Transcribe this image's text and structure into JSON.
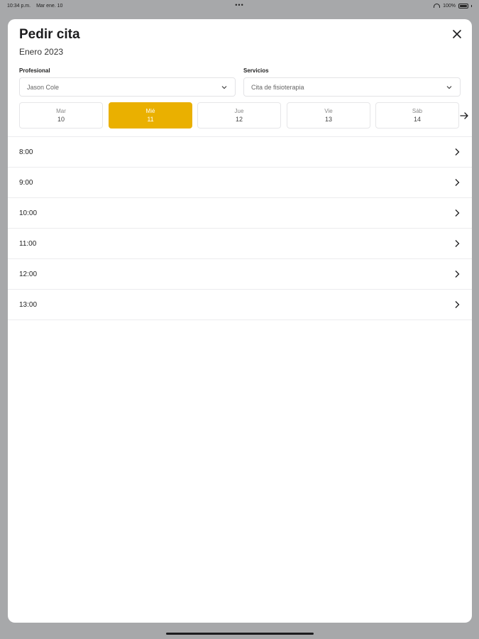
{
  "status_bar": {
    "time": "10:34 p.m.",
    "date": "Mar ene. 10",
    "dots": "•••",
    "battery": "100%"
  },
  "sheet": {
    "title": "Pedir cita",
    "subtitle": "Enero 2023"
  },
  "filters": {
    "professional_label": "Profesional",
    "professional_value": "Jason Cole",
    "services_label": "Servicios",
    "services_value": "Cita de fisioterapia"
  },
  "days": [
    {
      "dow": "Mar",
      "num": "10",
      "selected": false
    },
    {
      "dow": "Mié",
      "num": "11",
      "selected": true
    },
    {
      "dow": "Jue",
      "num": "12",
      "selected": false
    },
    {
      "dow": "Vie",
      "num": "13",
      "selected": false
    },
    {
      "dow": "Sáb",
      "num": "14",
      "selected": false
    }
  ],
  "slots": [
    "8:00",
    "9:00",
    "10:00",
    "11:00",
    "12:00",
    "13:00"
  ],
  "colors": {
    "accent": "#eab000",
    "background": "#a7a8aa"
  },
  "icons": {
    "close": "close-icon",
    "chevron_down": "chevron-down-icon",
    "chevron_right": "chevron-right-icon",
    "arrow_right": "arrow-right-icon"
  }
}
